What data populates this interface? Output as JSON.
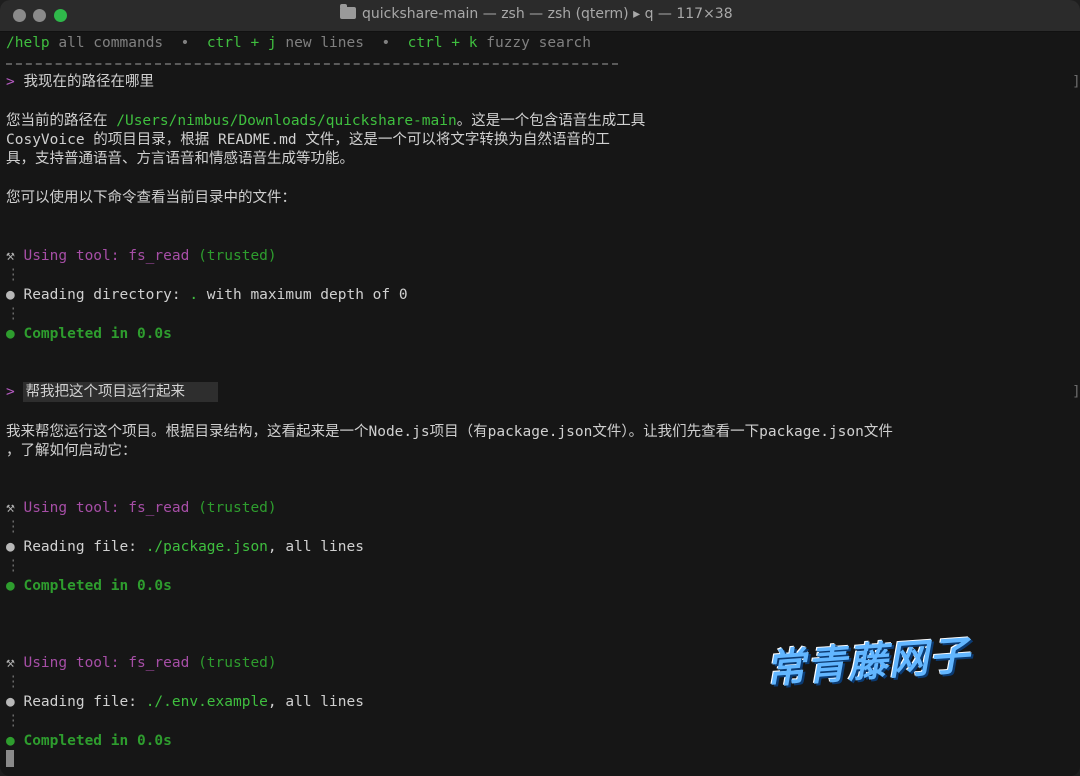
{
  "window": {
    "title": "quickshare-main — zsh — zsh (qterm) ▸ q — 117×38"
  },
  "help_bar": {
    "cmd1": "/help",
    "desc1": "all commands",
    "sep": "•",
    "cmd2": "ctrl + j",
    "desc2": "new lines",
    "cmd3": "ctrl + k",
    "desc3": "fuzzy search"
  },
  "conversation": {
    "prompt_marker": ">",
    "q1": "我现在的路径在哪里",
    "a1_line1_pre": "您当前的路径在 ",
    "a1_path": "/Users/nimbus/Downloads/quickshare-main",
    "a1_line1_post": "。这是一个包含语音生成工具",
    "a1_line2": "CosyVoice 的项目目录，根据 README.md 文件，这是一个可以将文字转换为自然语音的工",
    "a1_line3": "具，支持普通语音、方言语音和情感语音生成等功能。",
    "a1_line4": "您可以使用以下命令查看当前目录中的文件：",
    "tool1": {
      "using": "Using tool: fs_read",
      "trusted": "(trusted)",
      "action_label": "Reading directory: ",
      "action_target": ".",
      "action_rest": " with maximum depth of 0",
      "completed": "Completed in 0.0s"
    },
    "q2": "帮我把这个项目运行起来",
    "a2_line1": "我来帮您运行这个项目。根据目录结构，这看起来是一个Node.js项目（有package.json文件）。让我们先查看一下package.json文件",
    "a2_line2": "，了解如何启动它：",
    "tool2": {
      "using": "Using tool: fs_read",
      "trusted": "(trusted)",
      "action_label": "Reading file: ",
      "action_target": "./package.json",
      "action_rest": ", all lines",
      "completed": "Completed in 0.0s"
    },
    "tool3": {
      "using": "Using tool: fs_read",
      "trusted": "(trusted)",
      "action_label": "Reading file: ",
      "action_target": "./.env.example",
      "action_rest": ", all lines",
      "completed": "Completed in 0.0s"
    }
  },
  "watermark": "常青藤网子",
  "icons": {
    "tool": "wrench-hammer-icon",
    "dots": "⋮",
    "bullet": "●"
  }
}
